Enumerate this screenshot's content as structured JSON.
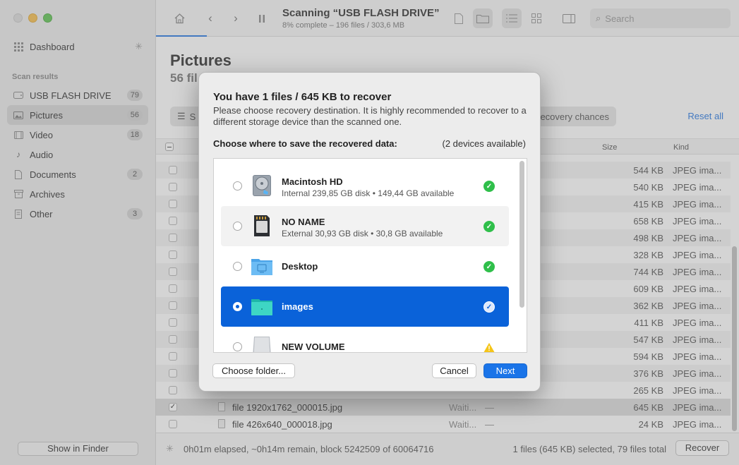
{
  "sidebar": {
    "dashboard": "Dashboard",
    "section_label": "Scan results",
    "items": [
      {
        "label": "USB FLASH DRIVE",
        "count": "79"
      },
      {
        "label": "Pictures",
        "count": "56"
      },
      {
        "label": "Video",
        "count": "18"
      },
      {
        "label": "Audio",
        "count": ""
      },
      {
        "label": "Documents",
        "count": "2"
      },
      {
        "label": "Archives",
        "count": ""
      },
      {
        "label": "Other",
        "count": "3"
      }
    ],
    "show_in_finder": "Show in Finder"
  },
  "toolbar": {
    "title": "Scanning “USB FLASH DRIVE”",
    "subtitle": "8% complete – 196 files / 303,6 MB",
    "search_placeholder": "Search"
  },
  "main": {
    "title": "Pictures",
    "subtitle": "56 fil",
    "filter_label": "S",
    "chances_label": "ecovery chances",
    "reset_all": "Reset all",
    "columns": {
      "size": "Size",
      "kind": "Kind"
    },
    "rows": [
      {
        "name": "",
        "status": "",
        "dash": "",
        "size": "544 KB",
        "kind": "JPEG ima...",
        "checked": false
      },
      {
        "name": "",
        "status": "",
        "dash": "",
        "size": "540 KB",
        "kind": "JPEG ima...",
        "checked": false
      },
      {
        "name": "",
        "status": "",
        "dash": "",
        "size": "415 KB",
        "kind": "JPEG ima...",
        "checked": false
      },
      {
        "name": "",
        "status": "",
        "dash": "",
        "size": "658 KB",
        "kind": "JPEG ima...",
        "checked": false
      },
      {
        "name": "",
        "status": "",
        "dash": "",
        "size": "498 KB",
        "kind": "JPEG ima...",
        "checked": false
      },
      {
        "name": "",
        "status": "",
        "dash": "",
        "size": "328 KB",
        "kind": "JPEG ima...",
        "checked": false
      },
      {
        "name": "",
        "status": "",
        "dash": "",
        "size": "744 KB",
        "kind": "JPEG ima...",
        "checked": false
      },
      {
        "name": "",
        "status": "",
        "dash": "",
        "size": "609 KB",
        "kind": "JPEG ima...",
        "checked": false
      },
      {
        "name": "",
        "status": "",
        "dash": "",
        "size": "362 KB",
        "kind": "JPEG ima...",
        "checked": false
      },
      {
        "name": "",
        "status": "",
        "dash": "",
        "size": "411 KB",
        "kind": "JPEG ima...",
        "checked": false
      },
      {
        "name": "",
        "status": "",
        "dash": "",
        "size": "547 KB",
        "kind": "JPEG ima...",
        "checked": false
      },
      {
        "name": "",
        "status": "",
        "dash": "",
        "size": "594 KB",
        "kind": "JPEG ima...",
        "checked": false
      },
      {
        "name": "",
        "status": "",
        "dash": "",
        "size": "376 KB",
        "kind": "JPEG ima...",
        "checked": false
      },
      {
        "name": "",
        "status": "",
        "dash": "",
        "size": "265 KB",
        "kind": "JPEG ima...",
        "checked": false
      },
      {
        "name": "file 1920x1762_000015.jpg",
        "status": "Waiti...",
        "dash": "—",
        "size": "645 KB",
        "kind": "JPEG ima...",
        "checked": true
      },
      {
        "name": "file 426x640_000018.jpg",
        "status": "Waiti...",
        "dash": "—",
        "size": "24 KB",
        "kind": "JPEG ima...",
        "checked": false
      }
    ]
  },
  "statusbar": {
    "elapsed": "0h01m elapsed, ~0h14m remain, block 5242509 of 60064716",
    "selection": "1 files (645 KB) selected, 79 files total",
    "recover": "Recover"
  },
  "modal": {
    "title": "You have 1 files / 645 KB to recover",
    "description": "Please choose recovery destination. It is highly recommended to recover to a different storage device than the scanned one.",
    "choose_label": "Choose where to save the recovered data:",
    "devices_available": "(2 devices available)",
    "destinations": [
      {
        "name": "Macintosh HD",
        "detail": "Internal 239,85 GB disk • 149,44 GB available",
        "icon": "hard-disk-icon",
        "status": "ok"
      },
      {
        "name": "NO NAME",
        "detail": "External 30,93 GB disk • 30,8 GB available",
        "icon": "sd-card-icon",
        "status": "ok"
      },
      {
        "name": "Desktop",
        "detail": "",
        "icon": "desktop-folder-icon",
        "status": "ok"
      },
      {
        "name": "images",
        "detail": "",
        "icon": "folder-icon",
        "status": "selected"
      },
      {
        "name": "NEW VOLUME",
        "detail": "",
        "icon": "volume-icon",
        "status": "warning"
      }
    ],
    "choose_folder": "Choose folder...",
    "cancel": "Cancel",
    "next": "Next"
  },
  "colors": {
    "accent": "#1a74e8",
    "selected_row": "#0a62d9",
    "ok_green": "#2fbf4a",
    "warning_yellow": "#f5c518"
  }
}
